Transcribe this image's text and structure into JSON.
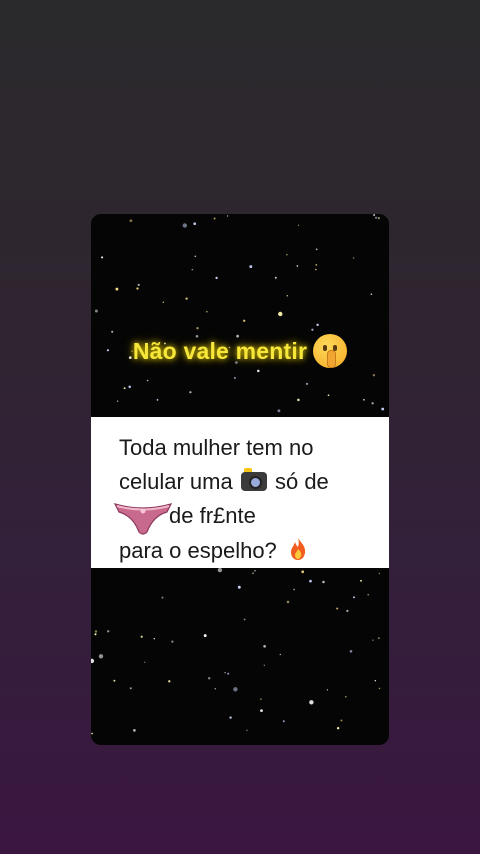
{
  "headline": {
    "text": "Não vale mentir",
    "emoji": "shushing-face"
  },
  "panel": {
    "line1": "Toda mulher tem no",
    "line2_prefix": "celular uma",
    "line2_emoji": "camera-flash",
    "line2_suffix": "só de",
    "line3_emoji": "panties",
    "line3_text": "de fr£nte",
    "line4": "para o espelho?",
    "line4_emoji": "fire"
  },
  "colors": {
    "headline": "#f6e73a",
    "panel_bg": "#ffffff",
    "card_bg": "#050505",
    "panty": "#c86a8e"
  }
}
